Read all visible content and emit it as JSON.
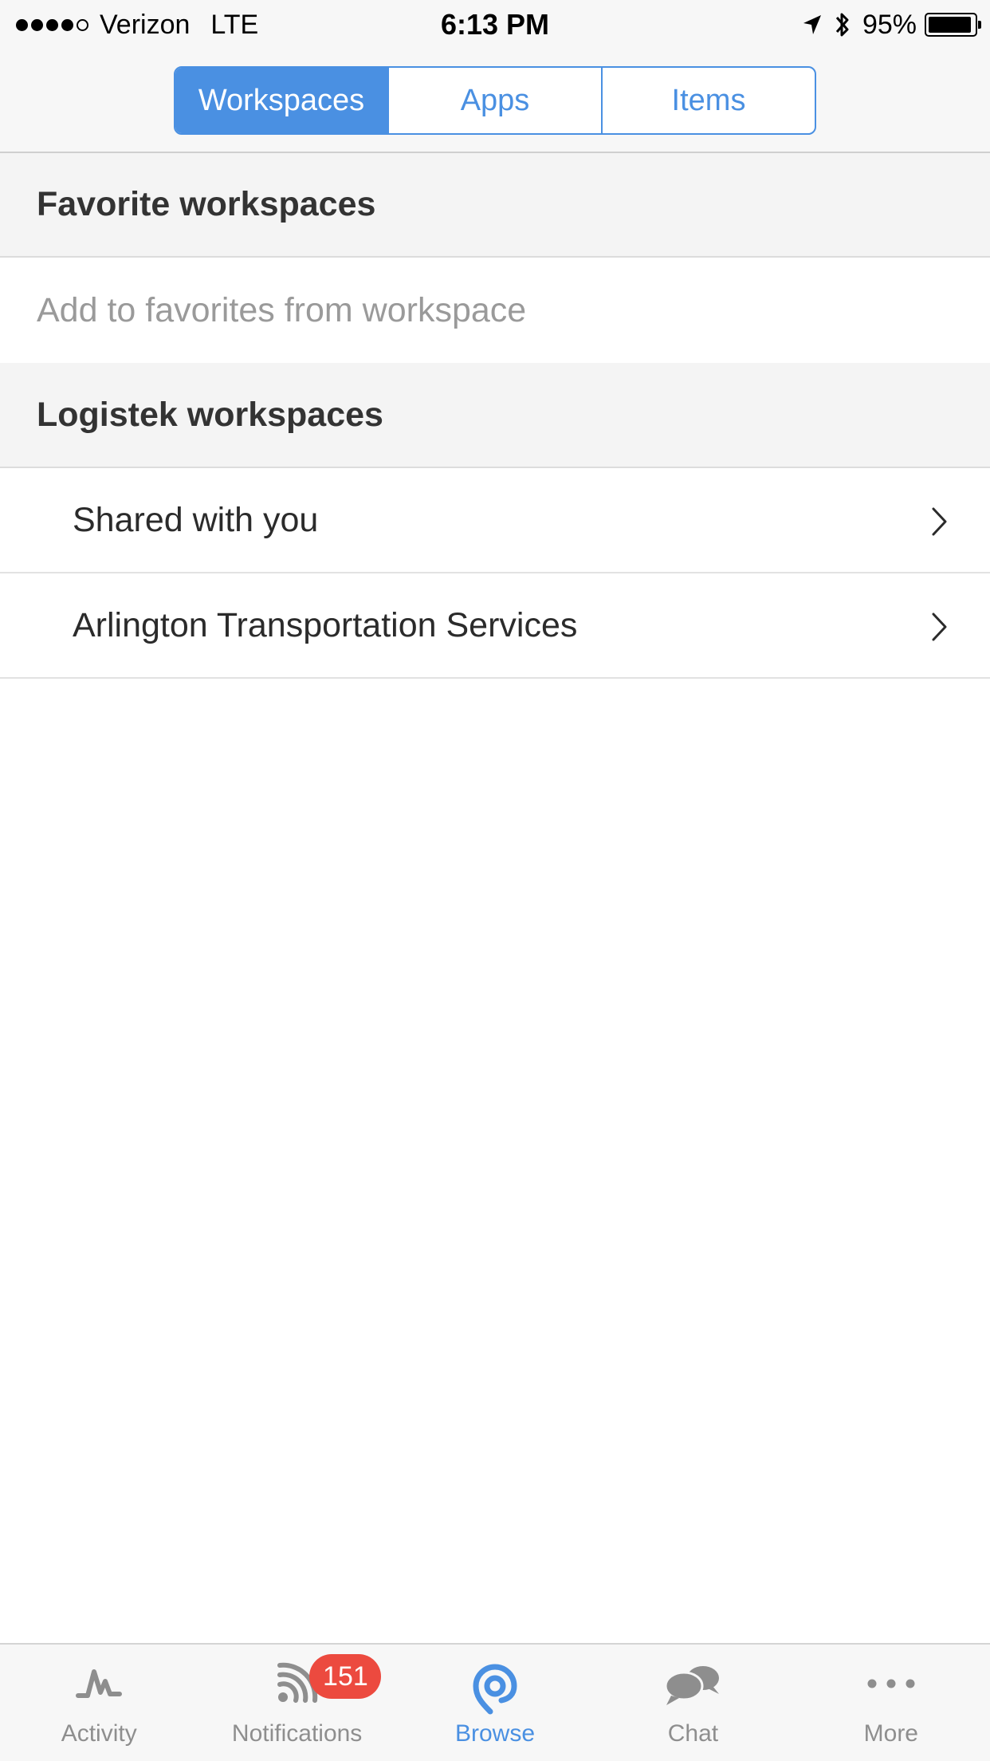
{
  "status_bar": {
    "carrier": "Verizon",
    "network": "LTE",
    "time": "6:13 PM",
    "battery_percent": "95%",
    "battery_level": 0.95,
    "signal_strength": 4,
    "signal_max": 5
  },
  "segments": [
    {
      "label": "Workspaces",
      "active": true
    },
    {
      "label": "Apps",
      "active": false
    },
    {
      "label": "Items",
      "active": false
    }
  ],
  "favorites": {
    "title": "Favorite workspaces",
    "placeholder": "Add to favorites from workspace"
  },
  "organization": {
    "title": "Logistek workspaces",
    "items": [
      {
        "label": "Shared with you",
        "icon": "chevron-right-icon"
      },
      {
        "label": "Arlington Transportation Services",
        "icon": "chevron-right-icon"
      }
    ]
  },
  "tab_bar": {
    "tabs": [
      {
        "label": "Activity",
        "icon": "activity-icon",
        "active": false
      },
      {
        "label": "Notifications",
        "icon": "notifications-icon",
        "active": false,
        "badge": "151"
      },
      {
        "label": "Browse",
        "icon": "browse-icon",
        "active": true
      },
      {
        "label": "Chat",
        "icon": "chat-icon",
        "active": false
      },
      {
        "label": "More",
        "icon": "more-icon",
        "active": false
      }
    ]
  },
  "colors": {
    "accent": "#4a90e2",
    "badge": "#ec4a3f",
    "header_bg": "#f4f4f4",
    "inactive_tab": "#8e8e8e"
  }
}
